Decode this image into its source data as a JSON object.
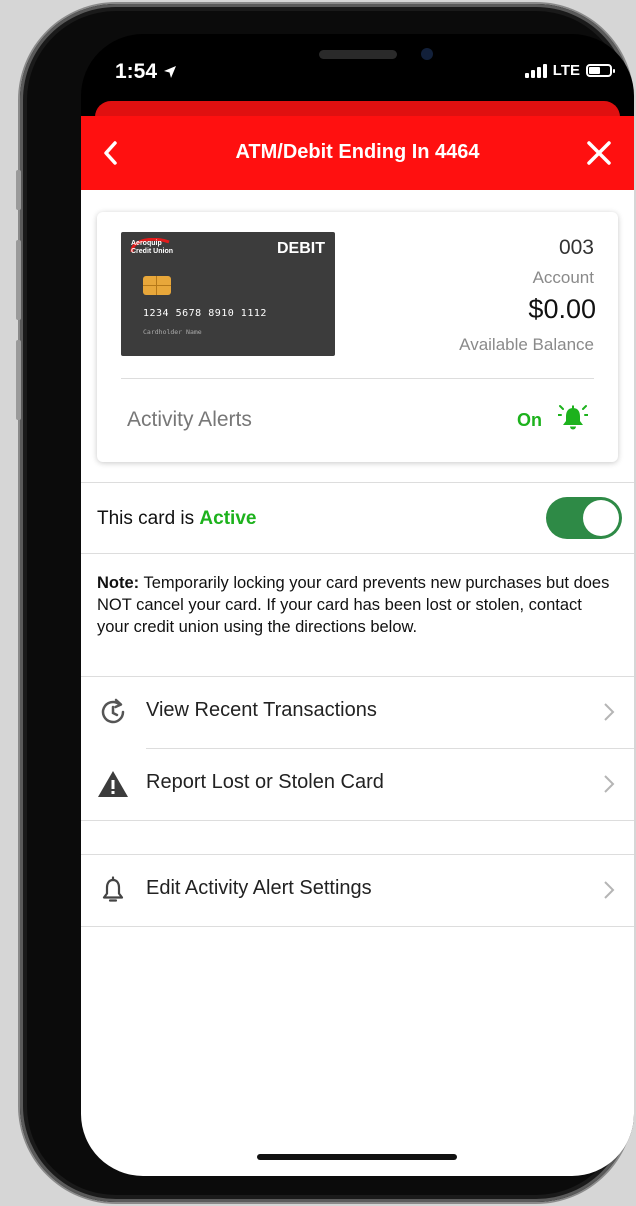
{
  "status_bar": {
    "time": "1:54",
    "network": "LTE"
  },
  "header": {
    "title": "ATM/Debit Ending In 4464"
  },
  "card": {
    "issuer_line1": "Aeroquip",
    "issuer_line2": "Credit Union",
    "type": "DEBIT",
    "number": "1234 5678 8910 1112",
    "holder": "Cardholder Name"
  },
  "account": {
    "number": "003",
    "number_label": "Account",
    "balance": "$0.00",
    "balance_label": "Available Balance"
  },
  "activity_alerts": {
    "label": "Activity Alerts",
    "status": "On"
  },
  "card_status": {
    "prefix": "This card is",
    "state": "Active",
    "toggle_on": true
  },
  "note": {
    "bold": "Note:",
    "text": " Temporarily locking your card prevents new purchases but does NOT cancel your card. If your card has been lost or stolen, contact your credit union using the directions below."
  },
  "menu": {
    "recent": "View Recent Transactions",
    "lost": "Report Lost or Stolen Card",
    "alerts": "Edit Activity Alert Settings"
  },
  "colors": {
    "brand_red": "#ff1010",
    "active_green": "#1db21d",
    "toggle_green": "#2e8a46"
  }
}
